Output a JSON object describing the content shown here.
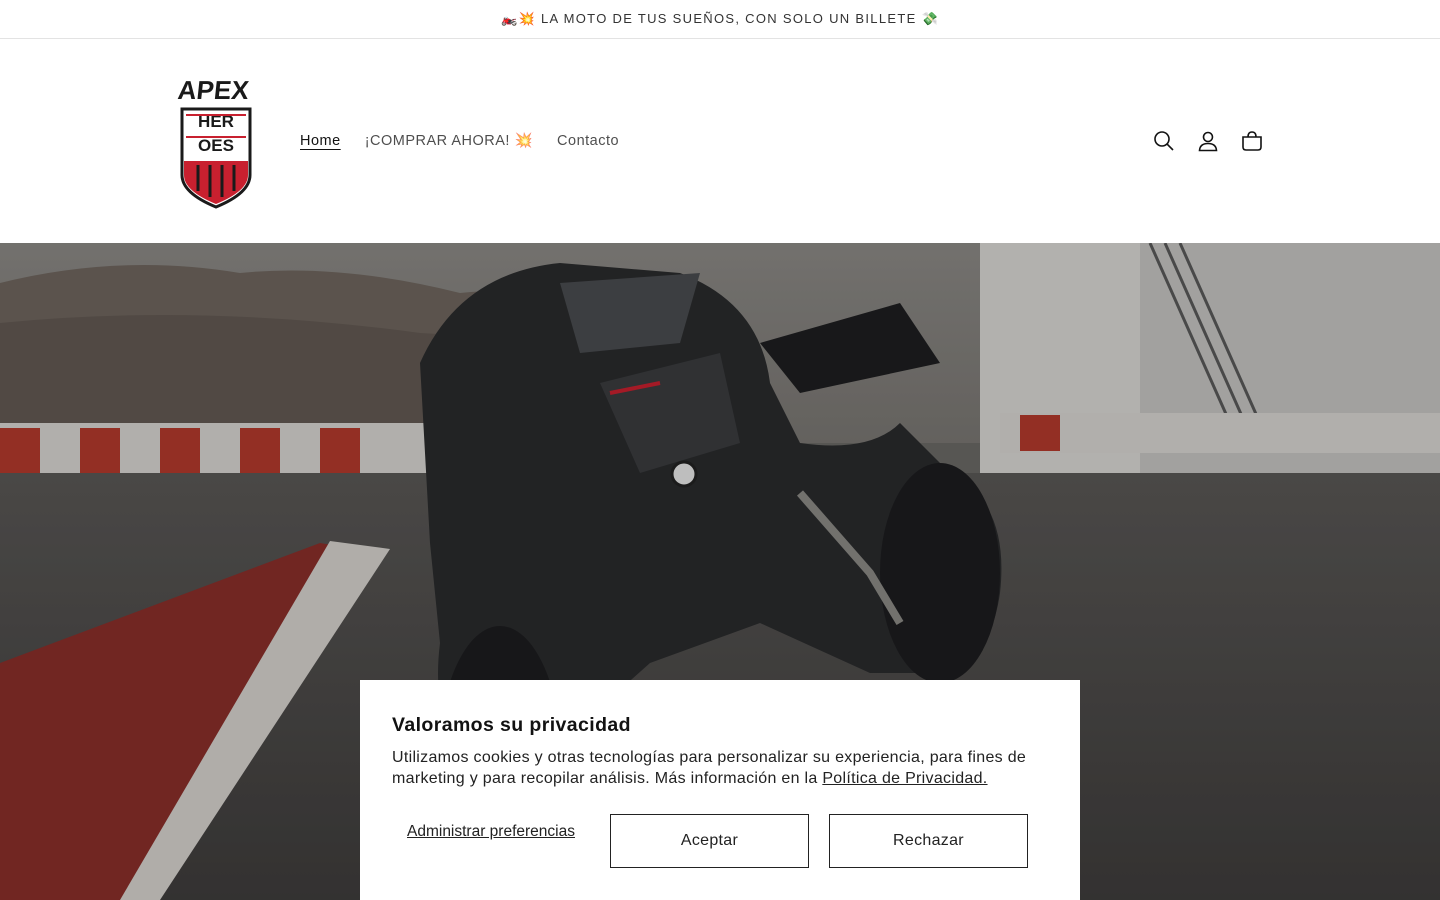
{
  "announcement": {
    "text": "🏍️💥 LA MOTO DE TUS SUEÑOS, CON SOLO UN BILLETE 💸"
  },
  "header": {
    "logo_text": "APEX HEROES",
    "nav": [
      {
        "label": "Home",
        "active": true
      },
      {
        "label": "¡COMPRAR AHORA! 💥",
        "active": false
      },
      {
        "label": "Contacto",
        "active": false
      }
    ],
    "icons": [
      "search-icon",
      "account-icon",
      "cart-icon"
    ]
  },
  "hero": {
    "heading": "",
    "image": "motorcycle-on-racetrack"
  },
  "cookie_banner": {
    "title": "Valoramos su privacidad",
    "body": "Utilizamos cookies y otras tecnologías para personalizar su experiencia, para fines de marketing y para recopilar análisis. Más información en la ",
    "policy_link": "Política de Privacidad.",
    "manage_label": "Administrar preferencias",
    "accept_label": "Aceptar",
    "reject_label": "Rechazar"
  },
  "colors": {
    "logo_red": "#c8202f",
    "text": "#121212",
    "border": "#e3e3e3"
  }
}
